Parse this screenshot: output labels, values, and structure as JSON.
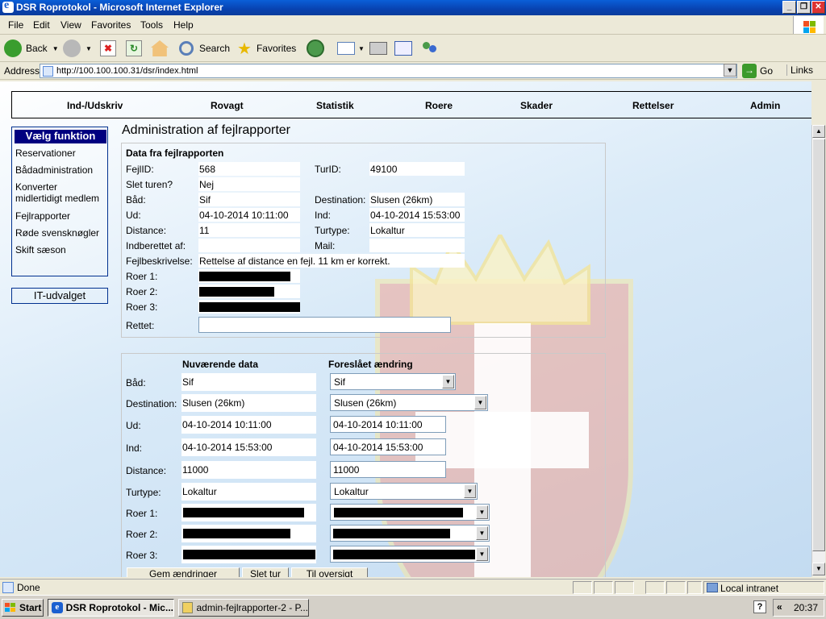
{
  "window": {
    "title": "DSR Roprotokol - Microsoft Internet Explorer",
    "controls": [
      "_",
      "❐",
      "✕"
    ]
  },
  "menubar": [
    "File",
    "Edit",
    "View",
    "Favorites",
    "Tools",
    "Help"
  ],
  "toolbar": {
    "back": "Back",
    "search": "Search",
    "favorites": "Favorites"
  },
  "addressbar": {
    "label": "Address",
    "url": "http://100.100.100.31/dsr/index.html",
    "go": "Go",
    "links": "Links"
  },
  "nav": [
    "Ind-/Udskriv",
    "Rovagt",
    "Statistik",
    "Roere",
    "Skader",
    "Rettelser",
    "Admin"
  ],
  "sidebar": {
    "header": "Vælg funktion",
    "items": [
      "Reservationer",
      "Bådadministration",
      "Konverter\nmidlertidigt medlem",
      "Fejlrapporter",
      "Røde svensknøgler",
      "Skift sæson"
    ],
    "it_button": "IT-udvalget"
  },
  "page": {
    "title": "Administration af fejlrapporter"
  },
  "report": {
    "heading": "Data fra fejlrapporten",
    "fejlid_label": "FejlID:",
    "fejlid": "568",
    "turid_label": "TurID:",
    "turid": "49100",
    "slet_label": "Slet turen?",
    "slet": "Nej",
    "baad_label": "Båd:",
    "baad": "Sif",
    "dest_label": "Destination:",
    "dest": "Slusen (26km)",
    "ud_label": "Ud:",
    "ud": "04-10-2014 10:11:00",
    "ind_label": "Ind:",
    "ind": "04-10-2014 15:53:00",
    "distance_label": "Distance:",
    "distance": "11",
    "turtype_label": "Turtype:",
    "turtype": "Lokaltur",
    "indberettet_label": "Indberettet af:",
    "indberettet": "",
    "mail_label": "Mail:",
    "mail": "",
    "beskrivelse_label": "Fejlbeskrivelse:",
    "beskrivelse": "Rettelse af distance en fejl. 11 km er korrekt.",
    "roer1_label": "Roer 1:",
    "roer2_label": "Roer 2:",
    "roer3_label": "Roer 3:",
    "rettet_label": "Rettet:",
    "rettet": ""
  },
  "compare": {
    "col_current": "Nuværende data",
    "col_proposed": "Foreslået ændring",
    "rows": [
      {
        "label": "Båd:",
        "current": "Sif",
        "proposed": "Sif"
      },
      {
        "label": "Destination:",
        "current": "Slusen (26km)",
        "proposed": "Slusen (26km)"
      },
      {
        "label": "Ud:",
        "current": "04-10-2014 10:11:00",
        "proposed": "04-10-2014 10:11:00"
      },
      {
        "label": "Ind:",
        "current": "04-10-2014 15:53:00",
        "proposed": "04-10-2014 15:53:00"
      },
      {
        "label": "Distance:",
        "current": "11000",
        "proposed": "11000"
      },
      {
        "label": "Turtype:",
        "current": "Lokaltur",
        "proposed": "Lokaltur"
      },
      {
        "label": "Roer 1:"
      },
      {
        "label": "Roer 2:"
      },
      {
        "label": "Roer 3:"
      }
    ],
    "buttons": [
      "Gem ændringer",
      "Slet tur",
      "Til oversigt"
    ]
  },
  "status": {
    "text": "Done",
    "zone": "Local intranet"
  },
  "taskbar": {
    "start": "Start",
    "tasks": [
      "DSR Roprotokol - Mic...",
      "admin-fejlrapporter-2 - P..."
    ],
    "clock": "20:37"
  },
  "colors": {
    "title_bar": "#0a4fc8",
    "sidebar_header": "#000080",
    "redaction": "#000000"
  }
}
